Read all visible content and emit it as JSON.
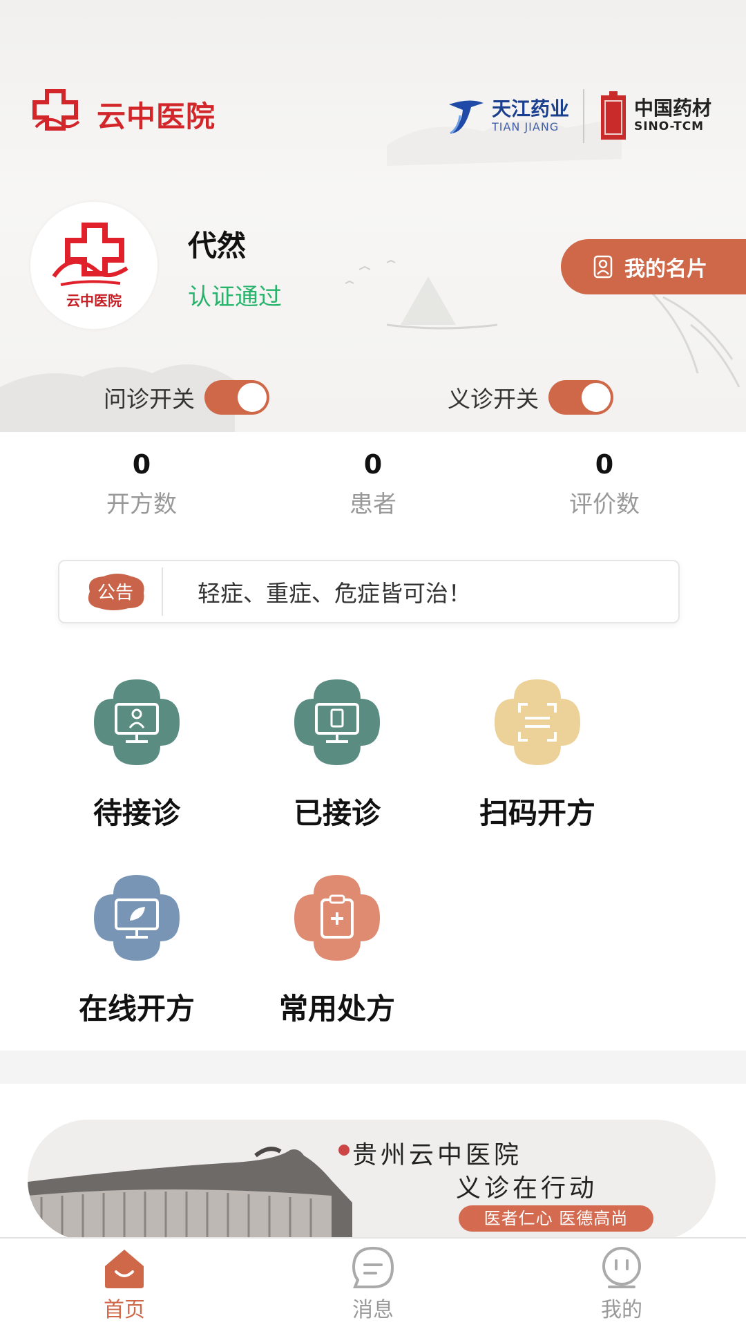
{
  "header": {
    "hospital_name": "云中医院",
    "partner1": {
      "name_cn": "天江药业",
      "name_en": "TIAN JIANG"
    },
    "partner2": {
      "name_cn": "中国药材",
      "name_en": "SINO-TCM"
    }
  },
  "profile": {
    "name": "代然",
    "status": "认证通过",
    "card_button": "我的名片",
    "avatar_caption": "云中医院"
  },
  "switches": [
    {
      "label": "问诊开关",
      "on": true
    },
    {
      "label": "义诊开关",
      "on": true
    }
  ],
  "stats": [
    {
      "value": "0",
      "label": "开方数"
    },
    {
      "value": "0",
      "label": "患者"
    },
    {
      "value": "0",
      "label": "评价数"
    }
  ],
  "notice": {
    "badge": "公告",
    "text": "轻症、重症、危症皆可治！"
  },
  "menu": [
    {
      "label": "待接诊",
      "icon": "monitor-doctor-icon",
      "color": "#5a8c82"
    },
    {
      "label": "已接诊",
      "icon": "monitor-document-icon",
      "color": "#5a8c82"
    },
    {
      "label": "扫码开方",
      "icon": "scan-icon",
      "color": "#ecd199"
    },
    {
      "label": "在线开方",
      "icon": "monitor-leaf-icon",
      "color": "#7895b6"
    },
    {
      "label": "常用处方",
      "icon": "clipboard-plus-icon",
      "color": "#de8b72"
    }
  ],
  "banner": {
    "title": "贵州云中医院",
    "subtitle": "义诊在行动",
    "tag": "医者仁心 医德高尚"
  },
  "tabbar": [
    {
      "label": "首页",
      "icon": "home-icon",
      "active": true
    },
    {
      "label": "消息",
      "icon": "message-icon",
      "active": false
    },
    {
      "label": "我的",
      "icon": "profile-icon",
      "active": false
    }
  ],
  "colors": {
    "accent": "#cf6848",
    "brand_red": "#d3262a",
    "status_green": "#27b36b"
  }
}
